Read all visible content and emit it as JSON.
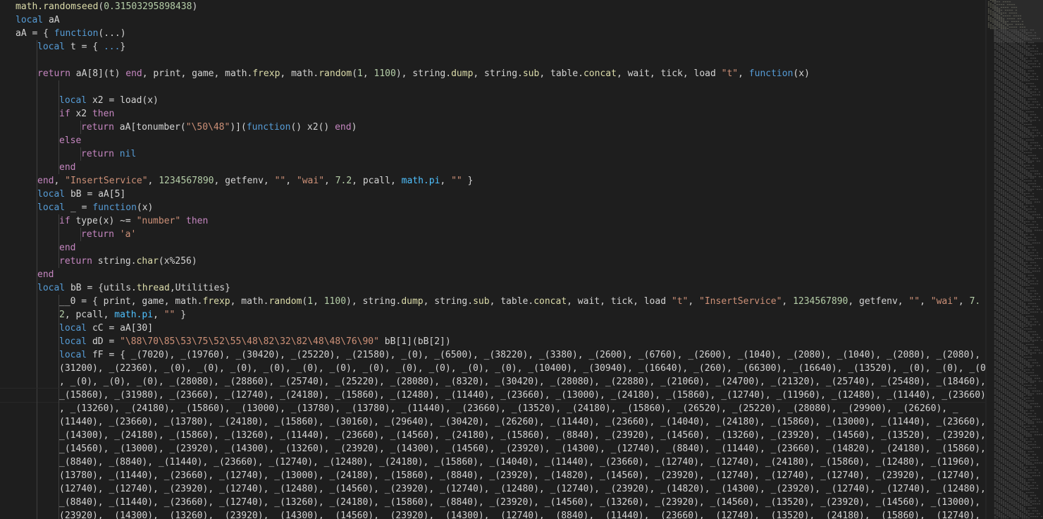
{
  "theme": {
    "background": "#1e1e1e",
    "foreground": "#d4d4d4",
    "keyword": "#569cd6",
    "control": "#c586c0",
    "string": "#ce9178",
    "number": "#b5cea8",
    "function": "#dcdcaa",
    "member": "#4fc1ff",
    "variable": "#9cdcfe"
  },
  "editor": {
    "lines": [
      {
        "indent": 0,
        "tokens": [
          [
            "fn",
            "math.randomseed"
          ],
          [
            "p",
            "("
          ],
          [
            "n",
            "0.31503295898438"
          ],
          [
            "p",
            ")"
          ]
        ]
      },
      {
        "indent": 0,
        "tokens": [
          [
            "k",
            "local"
          ],
          [
            "p",
            " aA"
          ]
        ]
      },
      {
        "indent": 0,
        "tokens": [
          [
            "p",
            "aA = { "
          ],
          [
            "k",
            "function"
          ],
          [
            "p",
            "(...)"
          ]
        ]
      },
      {
        "indent": 1,
        "tokens": [
          [
            "k",
            "local"
          ],
          [
            "p",
            " t = { "
          ],
          [
            "k",
            "..."
          ],
          [
            "p",
            "}"
          ]
        ]
      },
      {
        "indent": 1,
        "tokens": []
      },
      {
        "indent": 1,
        "tokens": [
          [
            "c",
            "return"
          ],
          [
            "p",
            " aA[8](t) "
          ],
          [
            "c",
            "end"
          ],
          [
            "p",
            ", print, game, math."
          ],
          [
            "fn",
            "frexp"
          ],
          [
            "p",
            ", math."
          ],
          [
            "fn",
            "random"
          ],
          [
            "p",
            "("
          ],
          [
            "n",
            "1"
          ],
          [
            "p",
            ", "
          ],
          [
            "n",
            "1100"
          ],
          [
            "p",
            "), string."
          ],
          [
            "fn",
            "dump"
          ],
          [
            "p",
            ", string."
          ],
          [
            "fn",
            "sub"
          ],
          [
            "p",
            ", table."
          ],
          [
            "fn",
            "concat"
          ],
          [
            "p",
            ", wait, tick, load "
          ],
          [
            "s",
            "\"t\""
          ],
          [
            "p",
            ", "
          ],
          [
            "k",
            "function"
          ],
          [
            "p",
            "(x)"
          ]
        ]
      },
      {
        "indent": 2,
        "tokens": []
      },
      {
        "indent": 2,
        "tokens": [
          [
            "k",
            "local"
          ],
          [
            "p",
            " x2 = load(x)"
          ]
        ]
      },
      {
        "indent": 2,
        "tokens": [
          [
            "c",
            "if"
          ],
          [
            "p",
            " x2 "
          ],
          [
            "c",
            "then"
          ]
        ]
      },
      {
        "indent": 3,
        "tokens": [
          [
            "c",
            "return"
          ],
          [
            "p",
            " aA[tonumber("
          ],
          [
            "s",
            "\"\\50\\48\""
          ],
          [
            "p",
            ")]("
          ],
          [
            "k",
            "function"
          ],
          [
            "p",
            "() x2() "
          ],
          [
            "c",
            "end"
          ],
          [
            "p",
            ")"
          ]
        ]
      },
      {
        "indent": 2,
        "tokens": [
          [
            "c",
            "else"
          ]
        ]
      },
      {
        "indent": 3,
        "tokens": [
          [
            "c",
            "return"
          ],
          [
            "p",
            " "
          ],
          [
            "k",
            "nil"
          ]
        ]
      },
      {
        "indent": 2,
        "tokens": [
          [
            "c",
            "end"
          ]
        ]
      },
      {
        "indent": 1,
        "tokens": [
          [
            "c",
            "end"
          ],
          [
            "p",
            ", "
          ],
          [
            "s",
            "\"InsertService\""
          ],
          [
            "p",
            ", "
          ],
          [
            "n",
            "1234567890"
          ],
          [
            "p",
            ", getfenv, "
          ],
          [
            "s",
            "\"\""
          ],
          [
            "p",
            ", "
          ],
          [
            "s",
            "\"wai\""
          ],
          [
            "p",
            ", "
          ],
          [
            "n",
            "7.2"
          ],
          [
            "p",
            ", pcall, "
          ],
          [
            "m",
            "math.pi"
          ],
          [
            "p",
            ", "
          ],
          [
            "s",
            "\"\""
          ],
          [
            "p",
            " }"
          ]
        ]
      },
      {
        "indent": 1,
        "tokens": [
          [
            "k",
            "local"
          ],
          [
            "p",
            " bB = aA[5]"
          ]
        ]
      },
      {
        "indent": 1,
        "tokens": [
          [
            "k",
            "local"
          ],
          [
            "p",
            " _ = "
          ],
          [
            "k",
            "function"
          ],
          [
            "p",
            "(x)"
          ]
        ]
      },
      {
        "indent": 2,
        "tokens": [
          [
            "c",
            "if"
          ],
          [
            "p",
            " type(x) ~= "
          ],
          [
            "s",
            "\"number\""
          ],
          [
            "p",
            " "
          ],
          [
            "c",
            "then"
          ]
        ]
      },
      {
        "indent": 3,
        "tokens": [
          [
            "c",
            "return"
          ],
          [
            "p",
            " "
          ],
          [
            "s",
            "'a'"
          ]
        ]
      },
      {
        "indent": 2,
        "tokens": [
          [
            "c",
            "end"
          ]
        ]
      },
      {
        "indent": 2,
        "tokens": [
          [
            "c",
            "return"
          ],
          [
            "p",
            " string."
          ],
          [
            "fn",
            "char"
          ],
          [
            "p",
            "(x%256)"
          ]
        ]
      },
      {
        "indent": 1,
        "tokens": [
          [
            "c",
            "end"
          ]
        ]
      },
      {
        "indent": 1,
        "tokens": [
          [
            "k",
            "local"
          ],
          [
            "p",
            " bB = {utils."
          ],
          [
            "fn",
            "thread"
          ],
          [
            "p",
            ",Utilities}"
          ]
        ]
      },
      {
        "indent": 2,
        "tokens": [
          [
            "p",
            "__0 = { print, game, math."
          ],
          [
            "fn",
            "frexp"
          ],
          [
            "p",
            ", math."
          ],
          [
            "fn",
            "random"
          ],
          [
            "p",
            "("
          ],
          [
            "n",
            "1"
          ],
          [
            "p",
            ", "
          ],
          [
            "n",
            "1100"
          ],
          [
            "p",
            "), string."
          ],
          [
            "fn",
            "dump"
          ],
          [
            "p",
            ", string."
          ],
          [
            "fn",
            "sub"
          ],
          [
            "p",
            ", table."
          ],
          [
            "fn",
            "concat"
          ],
          [
            "p",
            ", wait, tick, load "
          ],
          [
            "s",
            "\"t\""
          ],
          [
            "p",
            ", "
          ],
          [
            "s",
            "\"InsertService\""
          ],
          [
            "p",
            ", "
          ],
          [
            "n",
            "1234567890"
          ],
          [
            "p",
            ", getfenv, "
          ],
          [
            "s",
            "\"\""
          ],
          [
            "p",
            ", "
          ],
          [
            "s",
            "\"wai\""
          ],
          [
            "p",
            ", "
          ],
          [
            "n",
            "7."
          ]
        ]
      },
      {
        "indent": 2,
        "tokens": [
          [
            "n",
            "2"
          ],
          [
            "p",
            ", pcall, "
          ],
          [
            "m",
            "math.pi"
          ],
          [
            "p",
            ", "
          ],
          [
            "s",
            "\"\""
          ],
          [
            "p",
            " }"
          ]
        ]
      },
      {
        "indent": 2,
        "tokens": [
          [
            "k",
            "local"
          ],
          [
            "p",
            " cC = aA[30]"
          ]
        ]
      },
      {
        "indent": 2,
        "tokens": [
          [
            "k",
            "local"
          ],
          [
            "p",
            " dD = "
          ],
          [
            "s",
            "\"\\88\\70\\85\\53\\75\\52\\55\\48\\82\\32\\82\\48\\48\\76\\90\""
          ],
          [
            "p",
            " bB[1](bB[2])"
          ]
        ]
      },
      {
        "indent": 2,
        "tokens": [
          [
            "k",
            "local"
          ],
          [
            "p",
            " fF = { _(7020), _(19760), _(30420), _(25220), _(21580), _(0), _(6500), _(38220), _(3380), _(2600), _(6760), _(2600), _(1040), _(2080), _(1040), _(2080), _(2080), _"
          ]
        ]
      },
      {
        "indent": 2,
        "tokens": [
          [
            "p",
            "(31200), _(22360), _(0), _(0), _(0), _(0), _(0), _(0), _(0), _(0), _(0), _(0), _(0), _(10400), _(30940), _(16640), _(260), _(66300), _(16640), _(13520), _(0), _(0), _(0)"
          ]
        ]
      },
      {
        "indent": 2,
        "tokens": [
          [
            "p",
            ", _(0), _(0), _(0), _(28080), _(28860), _(25740), _(25220), _(28080), _(8320), _(30420), _(28080), _(22880), _(21060), _(24700), _(21320), _(25740), _(25480), _(18460),"
          ]
        ]
      },
      {
        "indent": 2,
        "current": true,
        "tokens": [
          [
            "p",
            "_(15860), _(31980), _(23660), _(12740), _(24180), _(15860), _(12480), _(11440), _(23660), _(13000), _(24180), _(15860), _(12740), _(11960), _(12480), _(11440), _(23660)"
          ]
        ]
      },
      {
        "indent": 2,
        "tokens": [
          [
            "p",
            ", _(13260), _(24180), _(15860), _(13000), _(13780), _(13780), _(11440), _(23660), _(13520), _(24180), _(15860), _(26520), _(25220), _(28080), _(29900), _(26260), _"
          ]
        ]
      },
      {
        "indent": 2,
        "tokens": [
          [
            "p",
            "(11440), _(23660), _(13780), _(24180), _(15860), _(30160), _(29640), _(30420), _(26260), _(11440), _(23660), _(14040), _(24180), _(15860), _(13000), _(11440), _(23660),"
          ]
        ]
      },
      {
        "indent": 2,
        "tokens": [
          [
            "p",
            "_(14300), _(24180), _(15860), _(13260), _(11440), _(23660), _(14560), _(24180), _(15860), _(8840), _(23920), _(14560), _(13260), _(23920), _(14560), _(13520), _(23920),"
          ]
        ]
      },
      {
        "indent": 2,
        "tokens": [
          [
            "p",
            "_(14560), _(13000), _(23920), _(14300), _(13260), _(23920), _(14300), _(14560), _(23920), _(14300), _(12740), _(8840), _(11440), _(23660), _(14820), _(24180), _(15860),"
          ]
        ]
      },
      {
        "indent": 2,
        "tokens": [
          [
            "p",
            "_(8840), _(8840), _(11440), _(23660), _(12740), _(12480), _(24180), _(15860), _(14040), _(11440), _(23660), _(12740), _(12740), _(24180), _(15860), _(12480), _(11960), _"
          ]
        ]
      },
      {
        "indent": 2,
        "tokens": [
          [
            "p",
            "(13780), _(11440), _(23660), _(12740), _(13000), _(24180), _(15860), _(8840), _(23920), _(14820), _(14560), _(23920), _(12740), _(12740), _(12740), _(23920), _(12740),"
          ]
        ]
      },
      {
        "indent": 2,
        "tokens": [
          [
            "p",
            "(12740), _(12740), _(23920), _(12740), _(12480), _(14560), _(23920), _(12740), _(12480), _(12740), _(23920), _(14820), _(14300), _(23920), _(12740), _(12740), _(12480),"
          ]
        ]
      },
      {
        "indent": 2,
        "tokens": [
          [
            "p",
            "_(8840), _(11440), _(23660), _(12740), _(13260), _(24180), _(15860), _(8840), _(23920), _(14560), _(13260), _(23920), _(14560), _(13520), _(23920), _(14560), _(13000), _"
          ]
        ]
      },
      {
        "indent": 2,
        "tokens": [
          [
            "p",
            "(23920), _(14300), _(13260), _(23920), _(14300), _(14560), _(23920), _(14300), _(12740), _(8840), _(11440), _(23660), _(12740), _(13520), _(24180), _(15860), _(12740),"
          ]
        ]
      }
    ]
  }
}
